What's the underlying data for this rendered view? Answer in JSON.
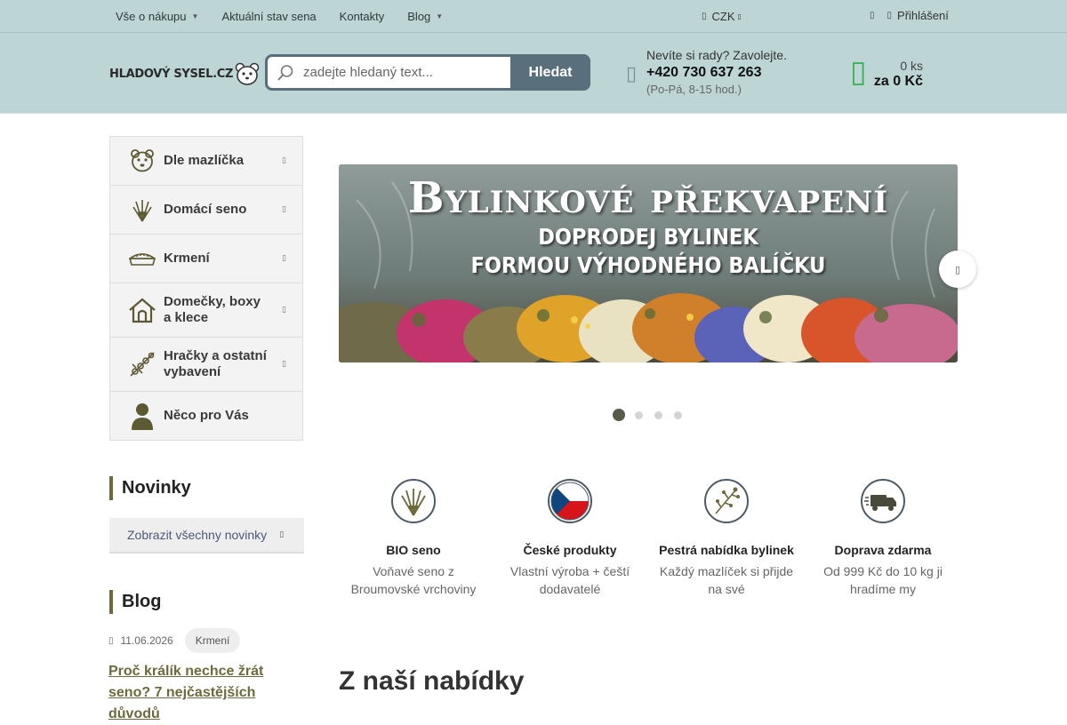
{
  "topbar": {
    "nav": [
      {
        "label": "Vše o nákupu",
        "caret": true
      },
      {
        "label": "Aktuální stav sena",
        "caret": false
      },
      {
        "label": "Kontakty",
        "caret": false
      },
      {
        "label": "Blog",
        "caret": true
      }
    ],
    "currency": "CZK",
    "login": "Přihlášení"
  },
  "header": {
    "logo_text": "HLADOVÝ SYSEL.CZ",
    "search_placeholder": "zadejte hledaný text...",
    "search_button": "Hledat",
    "contact_question": "Nevíte si rady? Zavolejte.",
    "phone": "+420 730 637 263",
    "hours": "(Po-Pá, 8-15 hod.)",
    "cart_count": "0 ks",
    "cart_total": "za 0 Kč"
  },
  "categories": [
    {
      "label": "Dle mazlíčka",
      "icon": "hamster-icon"
    },
    {
      "label": "Domácí seno",
      "icon": "hay-icon"
    },
    {
      "label": "Krmení",
      "icon": "food-bowl-icon"
    },
    {
      "label": "Domečky, boxy a klece",
      "icon": "house-icon"
    },
    {
      "label": "Hračky a ostatní vybavení",
      "icon": "toy-icon"
    },
    {
      "label": "Něco pro Vás",
      "icon": "person-icon"
    }
  ],
  "news": {
    "title": "Novinky",
    "button": "Zobrazit všechny novinky"
  },
  "blog": {
    "title": "Blog",
    "date": "11.06.2026",
    "tag": "Krmení",
    "post_title": "Proč králík nechce žrát seno? 7 nejčastějších důvodů"
  },
  "banner": {
    "title": "Bylinkové překvapení",
    "line1": "DOPRODEJ BYLINEK",
    "line2": "FORMOU VÝHODNÉHO BALÍČKU",
    "slides": 4,
    "active_slide": 1
  },
  "features": [
    {
      "title": "BIO seno",
      "desc": "Voňavé seno z Broumovské vrchoviny",
      "icon": "hay-bundle-icon"
    },
    {
      "title": "České produkty",
      "desc": "Vlastní výroba + čeští dodavatelé",
      "icon": "czech-flag-icon"
    },
    {
      "title": "Pestrá nabídka bylinek",
      "desc": "Každý mazlíček si přijde na své",
      "icon": "herbs-icon"
    },
    {
      "title": "Doprava zdarma",
      "desc": "Od 999 Kč do 10 kg ji hradíme my",
      "icon": "truck-icon"
    }
  ],
  "offer_title": "Z naší nabídky",
  "colors": {
    "header_bg": "#bdd5d5",
    "accent": "#6d6a3c",
    "search_border": "#5a6f7c",
    "cart_green": "#3bb35a"
  }
}
